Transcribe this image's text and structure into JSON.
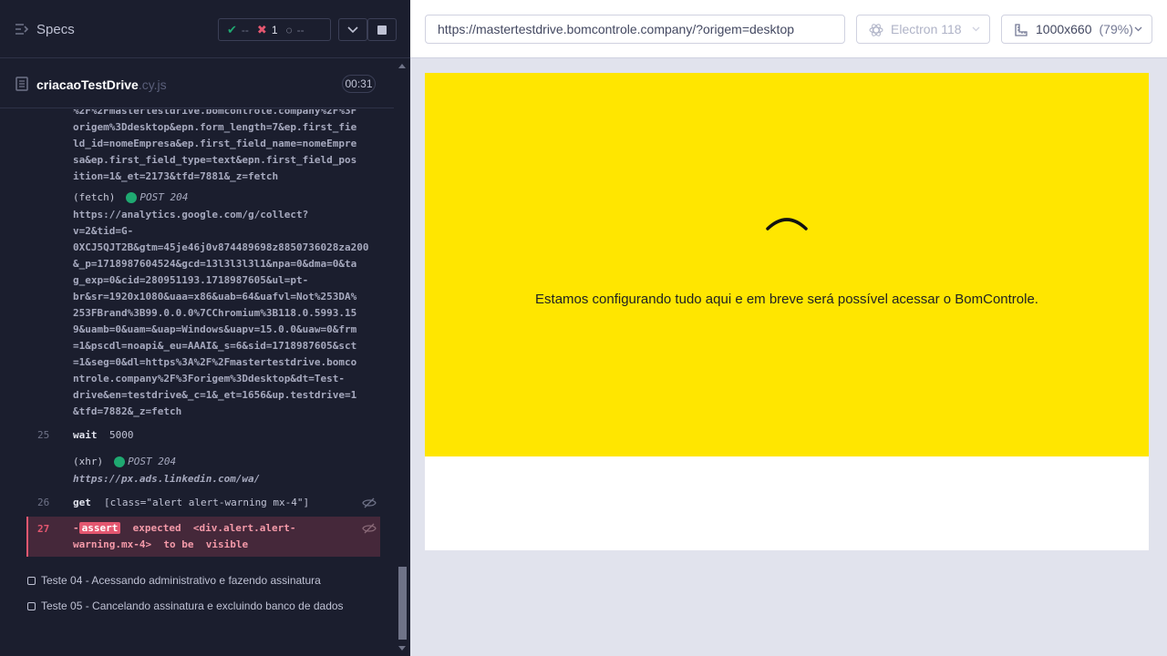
{
  "reporter": {
    "specs_label": "Specs",
    "stats": {
      "passed": "--",
      "failed": "1",
      "pending": "--"
    },
    "spec": {
      "name": "criacaoTestDrive",
      "ext": ".cy.js",
      "duration": "00:31"
    },
    "log_top_lines": [
      "%2F%2Fmastertestdrive.bomcontrole.company%2F%3F",
      "origem%3Ddesktop&epn.form_length=7&ep.first_fie",
      "ld_id=nomeEmpresa&ep.first_field_name=nomeEmpre",
      "sa&ep.first_field_type=text&epn.first_field_pos",
      "ition=1&_et=2173&tfd=7881&_z=fetch"
    ],
    "fetch1": {
      "type": "(fetch)",
      "method": "POST 204"
    },
    "fetch1_url_lines": [
      "https://analytics.google.com/g/collect?",
      "v=2&tid=G-",
      "0XCJ5QJT2B&gtm=45je46j0v874489698z8850736028za200",
      "&_p=1718987604524&gcd=13l3l3l3l1&npa=0&dma=0&ta",
      "g_exp=0&cid=280951193.1718987605&ul=pt-",
      "br&sr=1920x1080&uaa=x86&uab=64&uafvl=Not%253DA%",
      "253FBrand%3B99.0.0.0%7CChromium%3B118.0.5993.15",
      "9&uamb=0&uam=&uap=Windows&uapv=15.0.0&uaw=0&frm",
      "=1&pscdl=noapi&_eu=AAAI&_s=6&sid=1718987605&sct",
      "=1&seg=0&dl=https%3A%2F%2Fmastertestdrive.bomco",
      "ntrole.company%2F%3Forigem%3Ddesktop&dt=Test-",
      "drive&en=testdrive&_c=1&_et=1656&up.testdrive=1",
      "&tfd=7882&_z=fetch"
    ],
    "cmd25": {
      "num": "25",
      "name": "wait",
      "arg": "5000"
    },
    "xhr": {
      "type": "(xhr)",
      "method": "POST 204",
      "url": "https://px.ads.linkedin.com/wa/"
    },
    "cmd26": {
      "num": "26",
      "name": "get",
      "arg": "[class=\"alert alert-warning mx-4\"]"
    },
    "cmd27": {
      "num": "27",
      "prefix": "-",
      "badge": "assert",
      "line1": "expected",
      "tag": "<div.alert.alert-",
      "line2a": "warning.mx-4>",
      "line2b": "to be",
      "line2c": "visible"
    },
    "tests": [
      "Teste 04 - Acessando administrativo e fazendo assinatura",
      "Teste 05 - Cancelando assinatura e excluindo banco de dados"
    ]
  },
  "aut": {
    "url": "https://mastertestdrive.bomcontrole.company/?origem=desktop",
    "browser": "Electron 118",
    "viewport": "1000x660",
    "zoom": "(79%)",
    "message": "Estamos configurando tudo aqui e em breve será possível acessar o BomControle.",
    "page_color": "#ffe600"
  }
}
